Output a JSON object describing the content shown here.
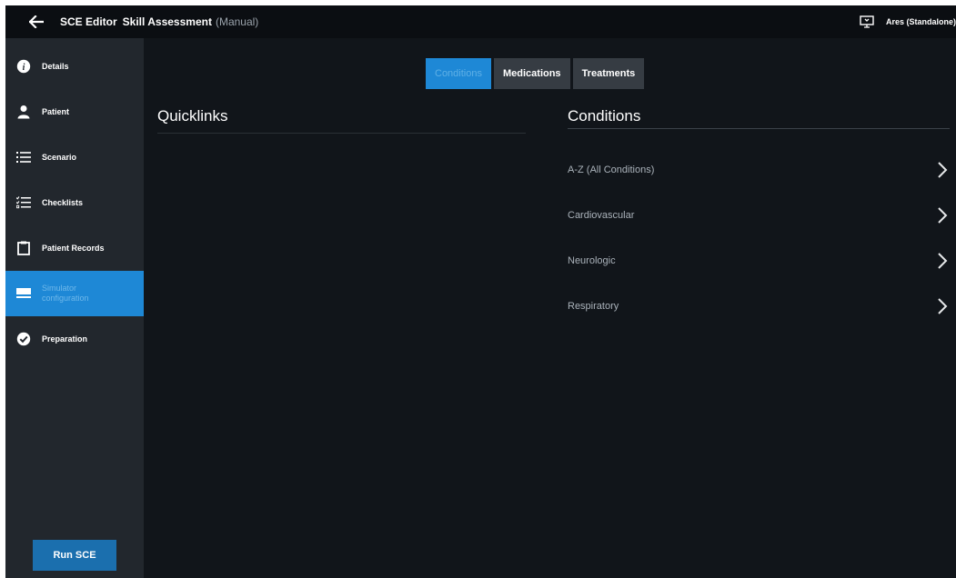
{
  "titlebar": {
    "app_name": "SCE Editor",
    "scenario_name": "Skill Assessment",
    "mode": "(Manual)",
    "device": "Ares (Standalone)"
  },
  "sidebar": {
    "items": [
      {
        "label": "Details",
        "icon": "info-icon"
      },
      {
        "label": "Patient",
        "icon": "person-icon"
      },
      {
        "label": "Scenario",
        "icon": "list-icon"
      },
      {
        "label": "Checklists",
        "icon": "checklist-icon"
      },
      {
        "label": "Patient Records",
        "icon": "clipboard-icon"
      },
      {
        "label": "Simulator configuration",
        "icon": "simulator-icon",
        "active": true
      },
      {
        "label": "Preparation",
        "icon": "check-circle-icon"
      }
    ],
    "run_button": "Run SCE"
  },
  "tabs": [
    {
      "label": "Conditions",
      "active": true
    },
    {
      "label": "Medications"
    },
    {
      "label": "Treatments"
    }
  ],
  "quicklinks": {
    "title": "Quicklinks"
  },
  "conditions": {
    "title": "Conditions",
    "items": [
      {
        "label": "A-Z (All Conditions)"
      },
      {
        "label": "Cardiovascular"
      },
      {
        "label": "Neurologic"
      },
      {
        "label": "Respiratory"
      }
    ]
  },
  "colors": {
    "accent": "#1e88d6",
    "sidebar_bg": "#22272d",
    "main_bg": "#11151a",
    "titlebar_bg": "#0b0e12"
  }
}
